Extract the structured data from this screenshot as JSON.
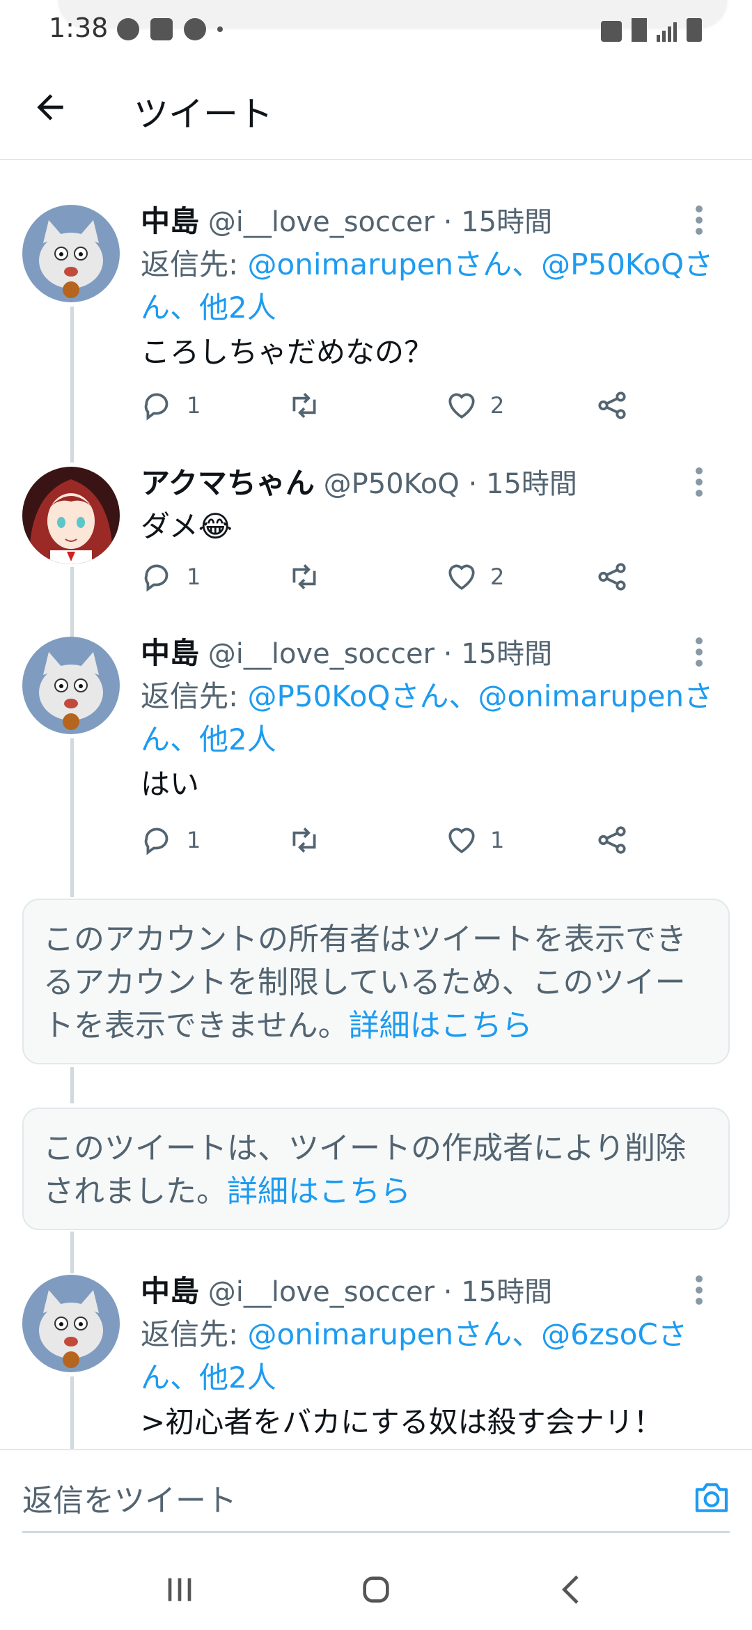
{
  "status_bar": {
    "time": "1:38"
  },
  "header": {
    "title": "ツイート"
  },
  "tweets": [
    {
      "name": "中島",
      "handle": "@i__love_soccer",
      "time": "· 15時間",
      "reply_prefix": "返信先: ",
      "reply_targets": "@onimarupenさん、@P50KoQさん、他2人",
      "text": "ころしちゃだめなの？",
      "reply_count": "1",
      "like_count": "2"
    },
    {
      "name": "アクマちゃん",
      "handle": "@P50KoQ",
      "time": "· 15時間",
      "text": "ダメ😂",
      "reply_count": "1",
      "like_count": "2"
    },
    {
      "name": "中島",
      "handle": "@i__love_soccer",
      "time": "· 15時間",
      "reply_prefix": "返信先: ",
      "reply_targets": "@P50KoQさん、@onimarupenさん、他2人",
      "text": "はい",
      "reply_count": "1",
      "like_count": "1"
    },
    {
      "name": "中島",
      "handle": "@i__love_soccer",
      "time": "· 15時間",
      "reply_prefix": "返信先: ",
      "reply_targets": "@onimarupenさん、@6zsoCさん、他2人",
      "text": ">初心者をバカにする奴は殺す会ナリ！"
    }
  ],
  "notices": [
    {
      "text": "このアカウントの所有者はツイートを表示できるアカウントを制限しているため、このツイートを表示できません。",
      "link": "詳細はこちら"
    },
    {
      "text": "このツイートは、ツイートの作成者により削除されました。",
      "link": "詳細はこちら"
    }
  ],
  "reply_bar": {
    "placeholder": "返信をツイート"
  },
  "colors": {
    "link": "#1d9bf0",
    "thread_line": "#cfd9de",
    "notice_bg": "#f7f9f9"
  },
  "icons": [
    "back-arrow-icon",
    "more-vertical-icon",
    "reply-icon",
    "retweet-icon",
    "like-icon",
    "share-icon",
    "camera-icon",
    "recent-apps-icon",
    "home-icon",
    "nav-back-icon"
  ]
}
